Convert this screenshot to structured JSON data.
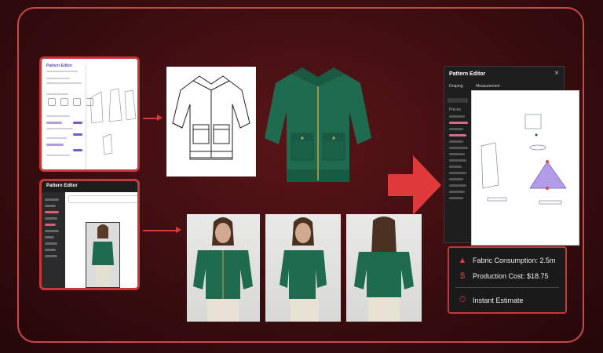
{
  "colors": {
    "accent": "#d9383c",
    "jacket": "#1f6b4f",
    "frame": "#c9484b"
  },
  "thumb_top": {
    "title": "Pattern Editor"
  },
  "thumb_bottom": {
    "title": "Pattern Editor"
  },
  "pattern_panel": {
    "title": "Pattern Editor",
    "tab_left": "Draping",
    "tab_right": "Measurement",
    "section_1": "Pieces",
    "close_icon": "×"
  },
  "cost_card": {
    "fabric": "Fabric Consumption: 2.5m",
    "production": "Production Cost: $18.75",
    "estimate": "Instant Estimate",
    "icons": [
      "jacket-icon",
      "dollar-icon",
      "stopwatch-icon"
    ]
  }
}
